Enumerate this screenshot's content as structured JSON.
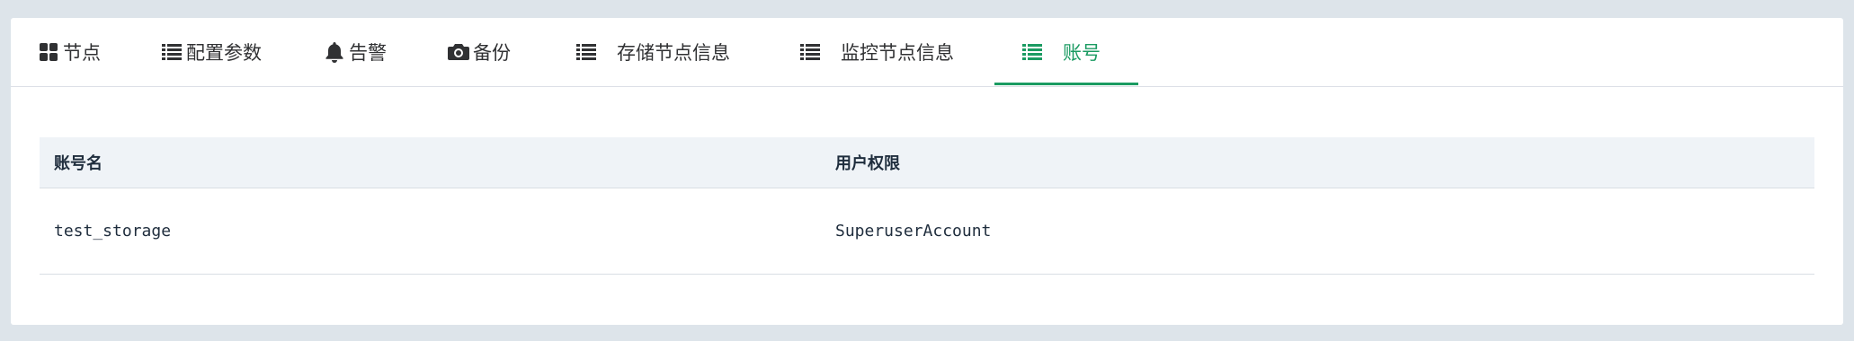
{
  "tabs": [
    {
      "label": "节点",
      "icon": "grid-icon",
      "active": false
    },
    {
      "label": "配置参数",
      "icon": "list-icon",
      "active": false
    },
    {
      "label": "告警",
      "icon": "bell-icon",
      "active": false
    },
    {
      "label": "备份",
      "icon": "camera-icon",
      "active": false
    },
    {
      "label": "存储节点信息",
      "icon": "list-icon",
      "active": false
    },
    {
      "label": "监控节点信息",
      "icon": "list-icon",
      "active": false
    },
    {
      "label": "账号",
      "icon": "list-icon",
      "active": true
    }
  ],
  "colors": {
    "accent": "#1b9b62",
    "page_bg": "#dde4ea",
    "table_header_bg": "#eff3f7"
  },
  "table": {
    "columns": [
      "账号名",
      "用户权限"
    ],
    "rows": [
      [
        "test_storage",
        "SuperuserAccount"
      ]
    ]
  }
}
